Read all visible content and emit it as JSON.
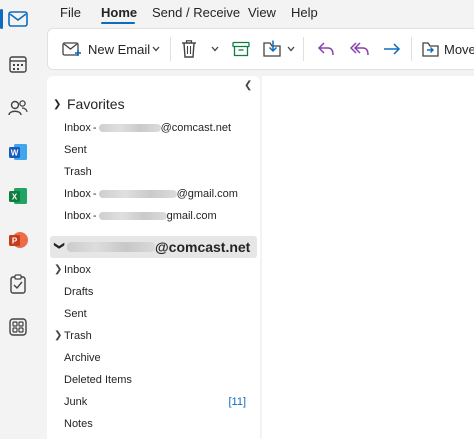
{
  "menu": {
    "file": "File",
    "home": "Home",
    "send_receive": "Send / Receive",
    "view": "View",
    "help": "Help"
  },
  "ribbon": {
    "new_email": "New Email",
    "move": "Move"
  },
  "favorites": {
    "title": "Favorites",
    "items": [
      {
        "label": "Inbox",
        "suffix": "@comcast.net"
      },
      {
        "label": "Sent"
      },
      {
        "label": "Trash"
      },
      {
        "label": "Inbox",
        "suffix": "@gmail.com"
      },
      {
        "label": "Inbox",
        "suffix": "gmail.com"
      }
    ]
  },
  "account": {
    "suffix": "@comcast.net",
    "folders": [
      {
        "label": "Inbox"
      },
      {
        "label": "Drafts"
      },
      {
        "label": "Sent"
      },
      {
        "label": "Trash"
      },
      {
        "label": "Archive"
      },
      {
        "label": "Deleted Items"
      },
      {
        "label": "Junk",
        "badge": "[11]"
      },
      {
        "label": "Notes"
      }
    ]
  },
  "colors": {
    "accent": "#0f6cbd",
    "word": "#185abd",
    "excel": "#107c41",
    "powerpoint": "#c43e1c"
  },
  "icons": {
    "rail": [
      "mail-icon",
      "calendar-icon",
      "people-icon",
      "word-icon",
      "excel-icon",
      "powerpoint-icon",
      "todo-icon",
      "apps-icon"
    ]
  }
}
